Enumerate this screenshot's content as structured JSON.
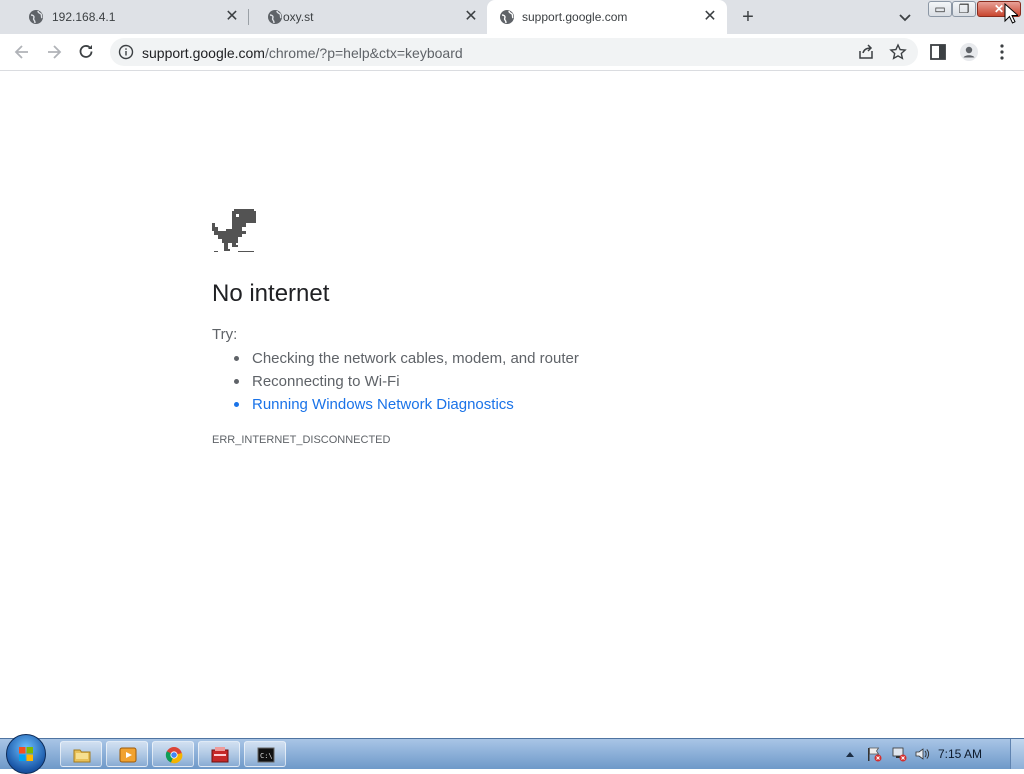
{
  "tabs": [
    {
      "title": "192.168.4.1",
      "active": false
    },
    {
      "title": "oxy.st",
      "active": false
    },
    {
      "title": "support.google.com",
      "active": true
    }
  ],
  "new_tab_label": "+",
  "omnibox": {
    "host": "support.google.com",
    "path": "/chrome/?p=help&ctx=keyboard"
  },
  "error_page": {
    "heading": "No internet",
    "try_label": "Try:",
    "suggestions": [
      "Checking the network cables, modem, and router",
      "Reconnecting to Wi-Fi"
    ],
    "diagnostics_link": "Running Windows Network Diagnostics",
    "error_code": "ERR_INTERNET_DISCONNECTED"
  },
  "taskbar": {
    "pinned": [
      "file-explorer-icon",
      "media-player-icon",
      "chrome-icon",
      "remote-tool-icon",
      "command-prompt-icon"
    ],
    "clock": "7:15 AM"
  },
  "colors": {
    "tabstrip": "#dee1e6",
    "link": "#1a73e8",
    "heading": "#202124",
    "secondary_text": "#5f6368"
  }
}
